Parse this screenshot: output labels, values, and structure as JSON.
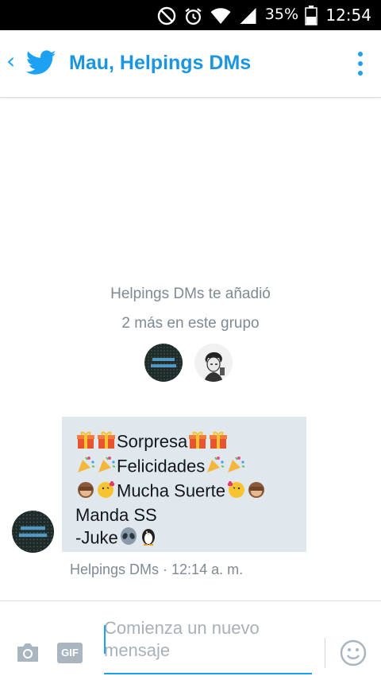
{
  "status_bar": {
    "battery_percent": "35%",
    "time": "12:54",
    "icons": [
      "dnd-icon",
      "alarm-icon",
      "wifi-icon",
      "signal-icon",
      "battery-icon"
    ]
  },
  "app_bar": {
    "back_icon": "chevron-left-icon",
    "logo_icon": "twitter-bird-icon",
    "title": "Mau, Helpings DMs",
    "overflow_icon": "more-vertical-icon",
    "accent": "#1da1f2"
  },
  "conversation": {
    "system_line1": "Helpings DMs te añadió",
    "system_line2": "2 más en este grupo",
    "participants": [
      "participant-avatar-helpings",
      "participant-avatar-person"
    ],
    "message": {
      "line1_text": "Sorpresa",
      "line2_text": "Felicidades",
      "line3_text": "Mucha Suerte",
      "line4_text": "Manda SS",
      "line5_text": "-Juke",
      "meta": "Helpings DMs · 12:14 a. m."
    }
  },
  "composer": {
    "placeholder_line1": "Comienza un nuevo",
    "placeholder_line2": "mensaje",
    "gif_label": "GIF",
    "camera_icon": "camera-icon",
    "emoji_icon": "smiley-icon"
  }
}
